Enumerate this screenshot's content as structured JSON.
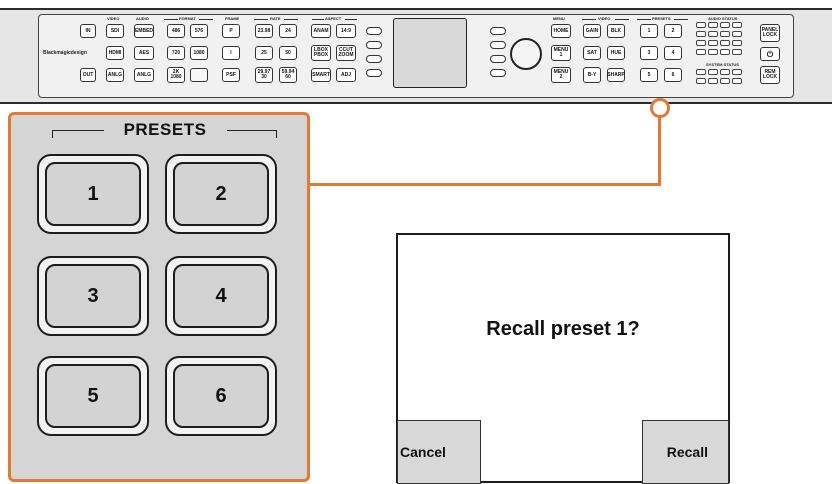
{
  "rack": {
    "row1": [
      "IN",
      "SDI",
      "EMBED",
      "486",
      "576",
      "P",
      "23.98",
      "24",
      "ANAM",
      "14:9"
    ],
    "row2": [
      "HDMI",
      "AES",
      "720",
      "1080",
      "I",
      "25",
      "50",
      "LBOX PBOX",
      "CCUT ZOOM"
    ],
    "row3": [
      "OUT",
      "ANLG",
      "ANLG",
      "2K 1080",
      "",
      "PSF",
      "29.97 30",
      "59.94 60",
      "SMART",
      "ADJ"
    ],
    "group_labels": [
      "VIDEO",
      "AUDIO",
      "FORMAT",
      "FRAME",
      "RATE",
      "ASPECT",
      "MENU",
      "VIDEO",
      "PRESETS",
      "AUDIO STATUS",
      "SYSTEM STATUS"
    ],
    "brand": "Blackmagicdesign",
    "menu_keys": [
      "HOME",
      "MENU 1",
      "MENU 2"
    ],
    "video_keys": [
      "GAIN",
      "BLK",
      "SAT",
      "HUE",
      "B-Y",
      "SHARP"
    ],
    "preset_keys": [
      "1",
      "2",
      "3",
      "4",
      "5",
      "6"
    ],
    "lock_keys": [
      "PANEL LOCK",
      "REM LOCK"
    ],
    "power_icon": "power-icon"
  },
  "presets_panel": {
    "title": "PRESETS",
    "keys": [
      "1",
      "2",
      "3",
      "4",
      "5",
      "6"
    ]
  },
  "dialog": {
    "message": "Recall preset 1?",
    "cancel_label": "Cancel",
    "recall_label": "Recall"
  },
  "colors": {
    "accent": "#e07a35",
    "panel_bg": "#d5d5d5",
    "key_face": "#d3d3d3"
  }
}
